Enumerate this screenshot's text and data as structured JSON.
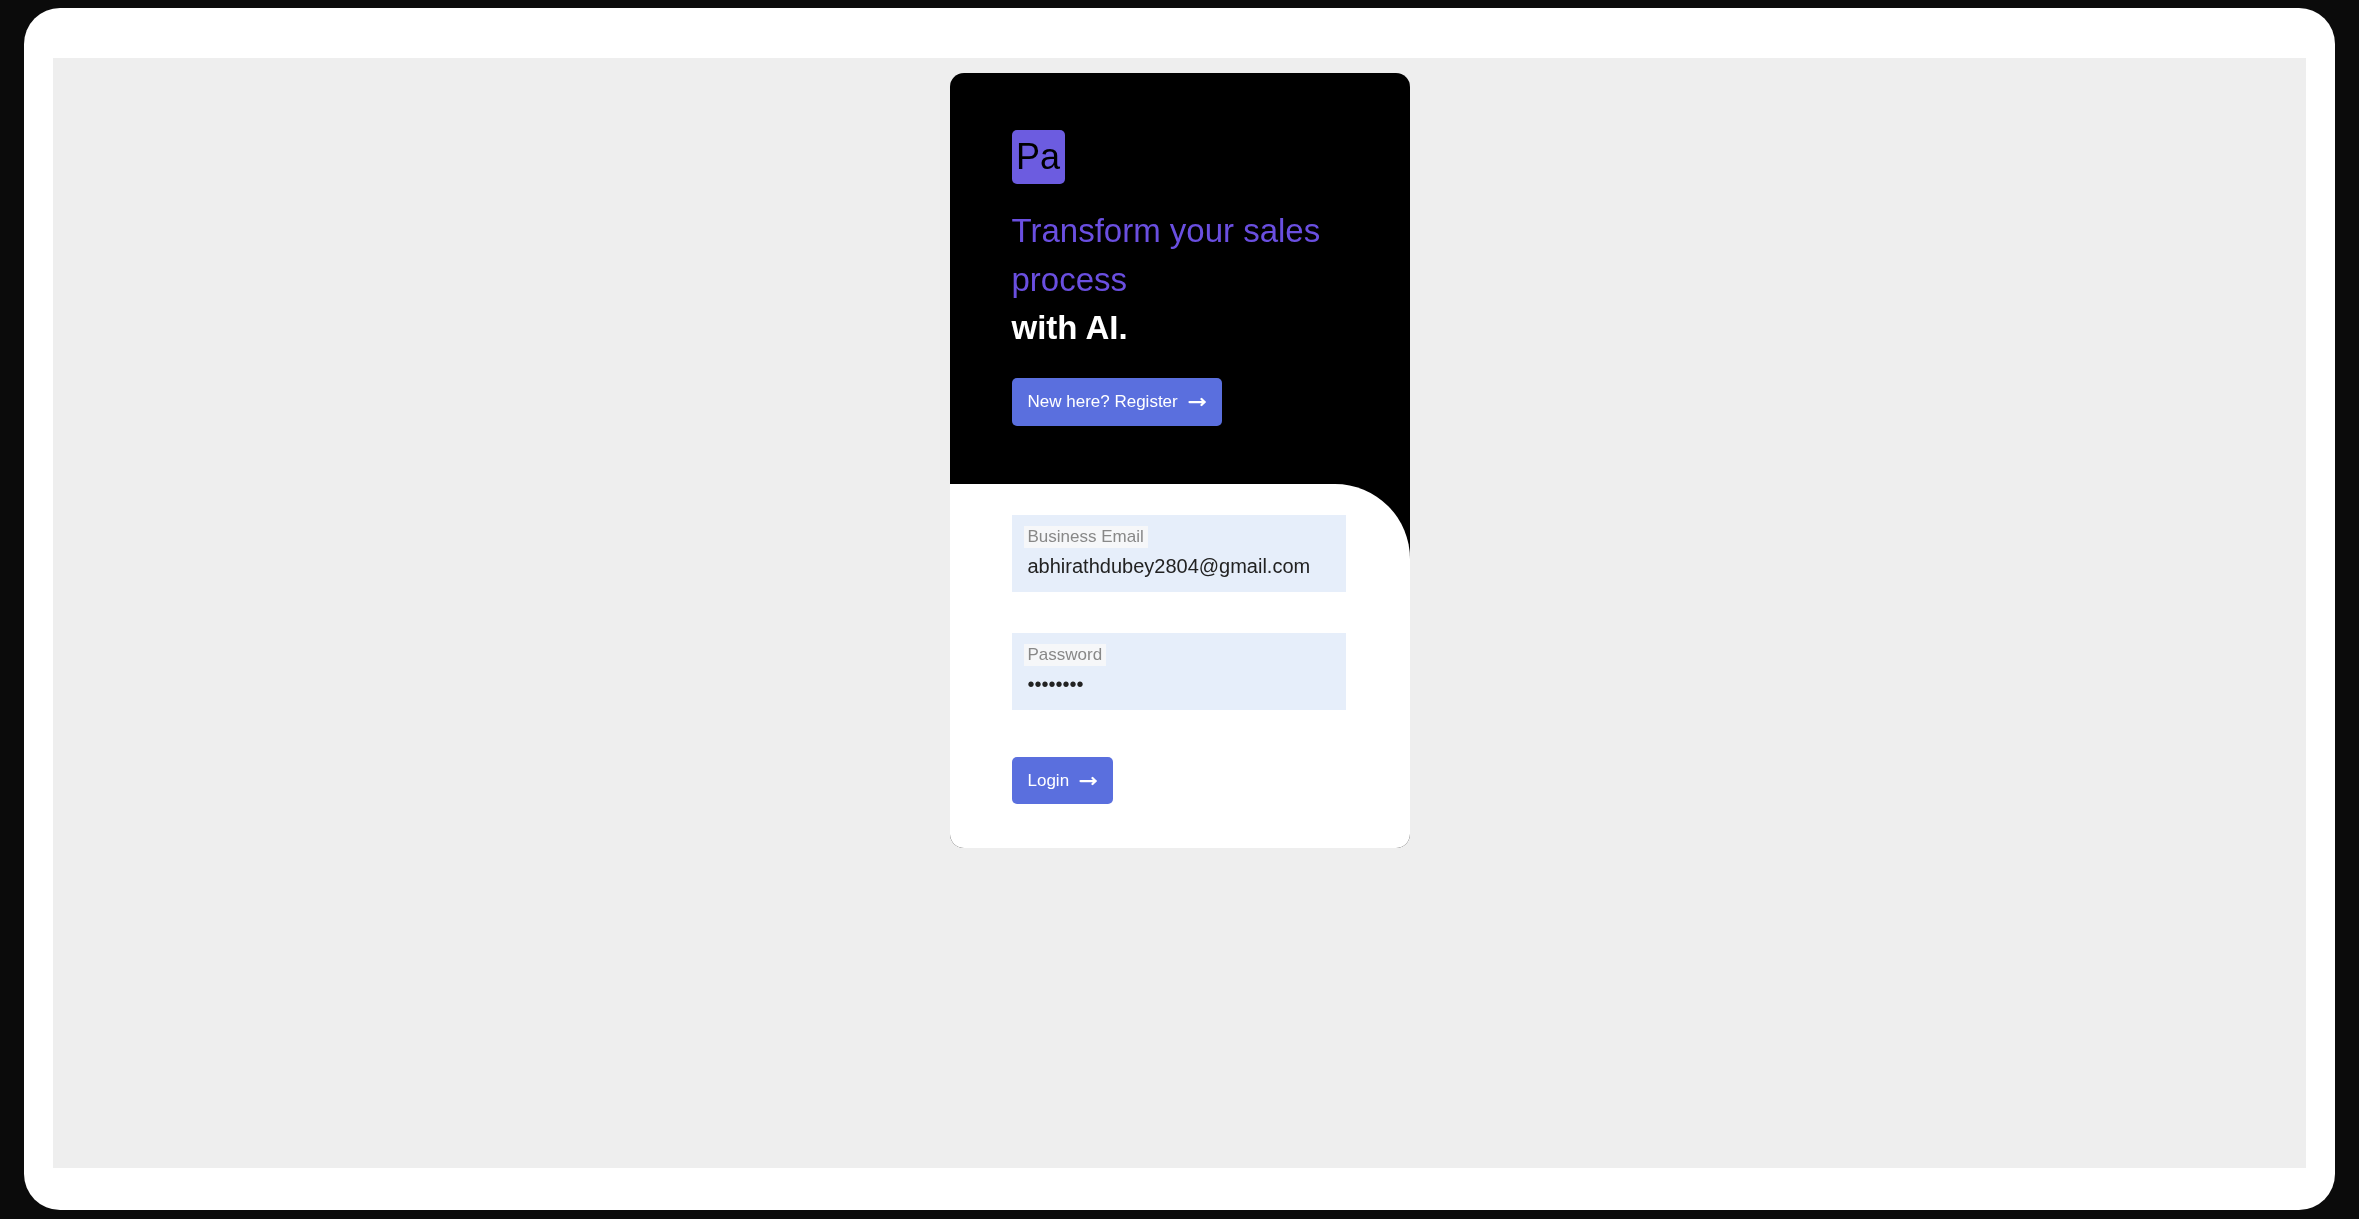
{
  "logo": {
    "text": "Pa"
  },
  "headline": {
    "accent": "Transform your sales process",
    "rest": "with AI."
  },
  "register_button": {
    "label": "New here? Register"
  },
  "fields": [
    {
      "label": "Business Email",
      "value": "abhirathdubey2804@gmail.com"
    },
    {
      "label": "Password",
      "value": "••••••••"
    }
  ],
  "login_button": {
    "label": "Login"
  }
}
